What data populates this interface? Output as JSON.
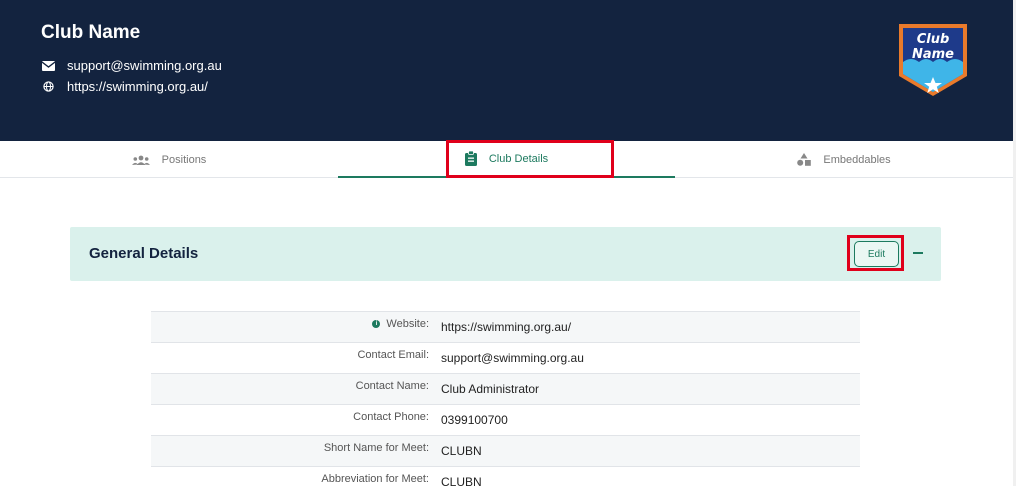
{
  "header": {
    "club_name": "Club Name",
    "email": "support@swimming.org.au",
    "website": "https://swimming.org.au/",
    "logo_text_line1": "Club",
    "logo_text_line2": "Name"
  },
  "tabs": [
    {
      "label": "Positions",
      "icon": "people-group-icon",
      "active": false
    },
    {
      "label": "Club Details",
      "icon": "clipboard-icon",
      "active": true
    },
    {
      "label": "Embeddables",
      "icon": "shapes-icon",
      "active": false
    }
  ],
  "section": {
    "title": "General Details",
    "edit_label": "Edit"
  },
  "details": [
    {
      "label": "Website:",
      "value": "https://swimming.org.au/",
      "info": true
    },
    {
      "label": "Contact Email:",
      "value": "support@swimming.org.au"
    },
    {
      "label": "Contact Name:",
      "value": "Club Administrator"
    },
    {
      "label": "Contact Phone:",
      "value": "0399100700"
    },
    {
      "label": "Short Name for Meet:",
      "value": "CLUBN"
    },
    {
      "label": "Abbreviation for Meet:",
      "value": "CLUBN"
    }
  ],
  "colors": {
    "header_bg": "#13233f",
    "accent_green": "#1d7a5f",
    "section_bg": "#daf1ec",
    "highlight_red": "#e0001b"
  }
}
